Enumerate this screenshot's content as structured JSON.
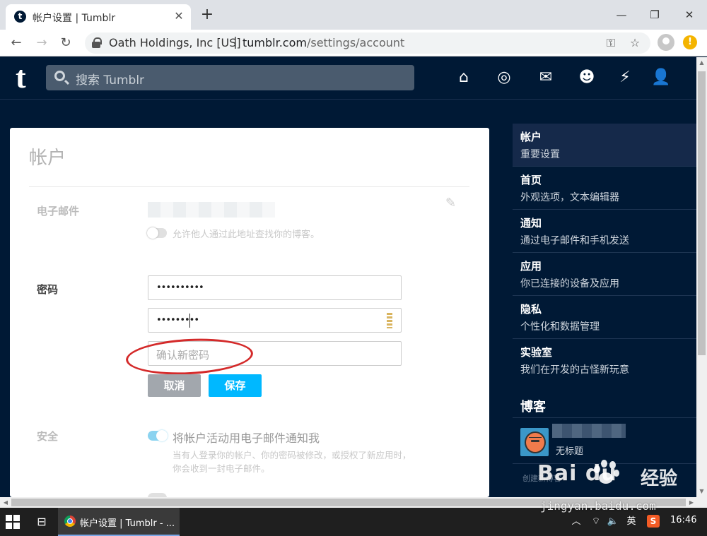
{
  "browser": {
    "tab_title": "帐户设置 | Tumblr",
    "tab_favicon_letter": "t",
    "new_tab_symbol": "+",
    "window_min": "—",
    "window_max": "❐",
    "window_close": "✕",
    "tab_close": "✕",
    "back": "←",
    "forward": "→",
    "reload": "↻",
    "cert_org": "Oath Holdings, Inc [US]",
    "url_sep": "|",
    "url_host": "tumblr.com",
    "url_path": "/settings/account",
    "key_icon": "⚿",
    "star_icon": "☆",
    "update_badge": "!"
  },
  "header": {
    "logo": "t",
    "search_placeholder": "搜索 Tumblr",
    "icons": [
      "home-icon",
      "explore-icon",
      "inbox-icon",
      "messaging-icon",
      "activity-icon",
      "account-icon"
    ],
    "glyphs": {
      "home": "⌂",
      "explore": "◎",
      "inbox": "✉",
      "messaging": "☻",
      "activity": "⚡",
      "account": "👤"
    }
  },
  "card": {
    "title": "帐户",
    "email": {
      "label": "电子邮件",
      "toggle_hint": "允许他人通过此地址查找你的博客。",
      "pencil": "✎"
    },
    "password": {
      "label": "密码",
      "current_value": "••••••••••",
      "new_value": "•••••••••",
      "confirm_placeholder": "确认新密码",
      "cancel_label": "取消",
      "save_label": "保存"
    },
    "security": {
      "label": "安全",
      "toggle_text": "将帐户活动用电子邮件通知我",
      "hint_line1": "当有人登录你的帐户、你的密码被修改，或授权了新应用时，",
      "hint_line2": "你会收到一封电子邮件。"
    }
  },
  "sidebar": {
    "items": [
      {
        "title": "帐户",
        "subtitle": "重要设置"
      },
      {
        "title": "首页",
        "subtitle": "外观选项，文本编辑器"
      },
      {
        "title": "通知",
        "subtitle": "通过电子邮件和手机发送"
      },
      {
        "title": "应用",
        "subtitle": "你已连接的设备及应用"
      },
      {
        "title": "隐私",
        "subtitle": "个性化和数据管理"
      },
      {
        "title": "实验室",
        "subtitle": "我们在开发的古怪新玩意"
      }
    ],
    "blogs_title": "博客",
    "blog_name": "无标题",
    "create_blog": "创建新博客"
  },
  "scrollbar": {
    "up": "▲",
    "down": "▼",
    "left": "◀",
    "right": "▶"
  },
  "taskbar": {
    "app_label": "帐户设置 | Tumblr - ...",
    "task_view": "⊟",
    "tray_up": "︿",
    "tray_net": "⌔",
    "tray_vol": "🔈",
    "ime": "英",
    "sogou": "S",
    "time": "16:46"
  },
  "watermark": {
    "logo": "Bai   du",
    "sub": "经验",
    "url": "jingyan.baidu.com"
  },
  "colors": {
    "tumblr_navy": "#001935",
    "save_button": "#00b8ff",
    "cancel_button": "#a2a7ad",
    "annotation": "#d42a2a",
    "toggle_on": "#8bd3f0"
  }
}
